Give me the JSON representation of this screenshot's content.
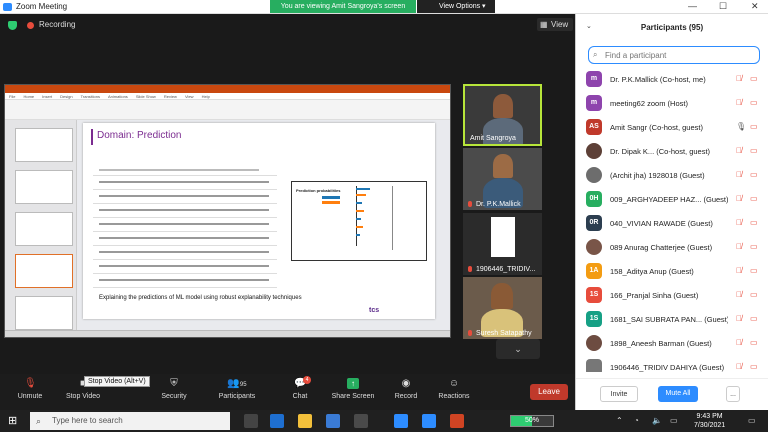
{
  "window": {
    "title": "Zoom Meeting",
    "minimize": "—",
    "maximize": "☐",
    "close": "✕"
  },
  "banner": {
    "viewing_text": "You are viewing Amit Sangroya's screen",
    "view_options": "View Options ▾"
  },
  "topbar": {
    "recording": "Recording",
    "view_button": "View"
  },
  "shared_slide": {
    "title": "Domain: Prediction",
    "caption": "Explaining the predictions of ML model using robust explanability techniques",
    "figure_label": "Prediction probabilities",
    "logo_text": "tcs"
  },
  "video_tiles": [
    {
      "name": "Amit Sangroya",
      "muted": false,
      "speaking": true
    },
    {
      "name": "Dr. P.K.Mallick",
      "muted": true
    },
    {
      "name": "1906446_TRIDIV...",
      "muted": true
    },
    {
      "name": "Suresh Satapathy",
      "muted": true
    }
  ],
  "more_videos_icon": "chevron-down-icon",
  "toolbar": {
    "unmute": "Unmute",
    "stop_video": "Stop Video",
    "tooltip": "Stop Video (Alt+V)",
    "security": "Security",
    "participants": "Participants",
    "participants_count": "95",
    "chat": "Chat",
    "chat_badge": "4",
    "share_screen": "Share Screen",
    "record": "Record",
    "reactions": "Reactions",
    "leave": "Leave"
  },
  "participants_panel": {
    "title": "Participants (95)",
    "search_placeholder": "Find a participant",
    "invite": "Invite",
    "mute_all": "Mute All",
    "more": "...",
    "people": [
      {
        "initials": "m",
        "name": "Dr. P.K.Mallick (Co-host, me)",
        "color": "#8e44ad",
        "photo": false,
        "mic": "muted",
        "cam": "on"
      },
      {
        "initials": "m",
        "name": "meeting62 zoom (Host)",
        "color": "#8e44ad",
        "photo": false,
        "mic": "muted",
        "cam": "off"
      },
      {
        "initials": "AS",
        "name": "Amit Sangr (Co-host, guest)",
        "color": "#c0392b",
        "photo": false,
        "mic": "on",
        "cam": "on"
      },
      {
        "initials": "",
        "name": "Dr. Dipak K... (Co-host, guest)",
        "color": "#5d4037",
        "photo": true,
        "mic": "muted",
        "cam": "off"
      },
      {
        "initials": "",
        "name": "(Archit jha) 1928018 (Guest)",
        "color": "#6d6d6d",
        "photo": true,
        "mic": "muted",
        "cam": "off"
      },
      {
        "initials": "0H",
        "name": "009_ARGHYADEEP HAZ... (Guest)",
        "color": "#27ae60",
        "photo": false,
        "mic": "muted",
        "cam": "off"
      },
      {
        "initials": "0R",
        "name": "040_VIVIAN RAWADE (Guest)",
        "color": "#2c3e50",
        "photo": false,
        "mic": "muted",
        "cam": "off"
      },
      {
        "initials": "",
        "name": "089 Anurag Chatterjee (Guest)",
        "color": "#795548",
        "photo": true,
        "mic": "muted",
        "cam": "off"
      },
      {
        "initials": "1A",
        "name": "158_Aditya Anup (Guest)",
        "color": "#f39c12",
        "photo": false,
        "mic": "muted",
        "cam": "off"
      },
      {
        "initials": "1S",
        "name": "166_Pranjal Sinha (Guest)",
        "color": "#e74c3c",
        "photo": false,
        "mic": "muted",
        "cam": "off"
      },
      {
        "initials": "1S",
        "name": "1681_SAI SUBRATA PAN... (Guest)",
        "color": "#16a085",
        "photo": false,
        "mic": "muted",
        "cam": "off"
      },
      {
        "initials": "",
        "name": "1898_Aneesh Barman (Guest)",
        "color": "#6d4c41",
        "photo": true,
        "mic": "muted",
        "cam": "off"
      },
      {
        "initials": "",
        "name": "1906446_TRIDIV DAHIYA (Guest)",
        "color": "#777777",
        "photo": false,
        "mic": "muted",
        "cam": "off"
      }
    ]
  },
  "taskbar": {
    "search_placeholder": "Type here to search",
    "battery_percent": 50,
    "battery_label": "50%",
    "time": "9:43 PM",
    "date": "7/30/2021"
  }
}
